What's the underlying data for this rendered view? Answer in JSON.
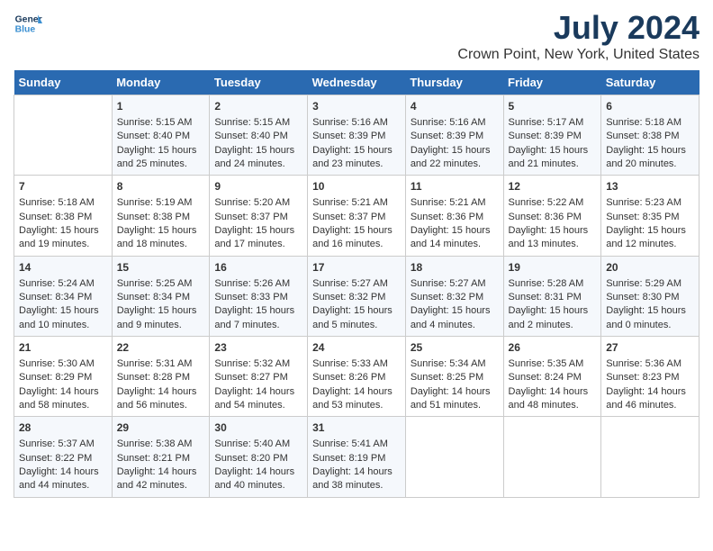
{
  "header": {
    "logo_line1": "General",
    "logo_line2": "Blue",
    "title": "July 2024",
    "subtitle": "Crown Point, New York, United States"
  },
  "weekdays": [
    "Sunday",
    "Monday",
    "Tuesday",
    "Wednesday",
    "Thursday",
    "Friday",
    "Saturday"
  ],
  "weeks": [
    [
      {
        "day": "",
        "lines": []
      },
      {
        "day": "1",
        "lines": [
          "Sunrise: 5:15 AM",
          "Sunset: 8:40 PM",
          "Daylight: 15 hours",
          "and 25 minutes."
        ]
      },
      {
        "day": "2",
        "lines": [
          "Sunrise: 5:15 AM",
          "Sunset: 8:40 PM",
          "Daylight: 15 hours",
          "and 24 minutes."
        ]
      },
      {
        "day": "3",
        "lines": [
          "Sunrise: 5:16 AM",
          "Sunset: 8:39 PM",
          "Daylight: 15 hours",
          "and 23 minutes."
        ]
      },
      {
        "day": "4",
        "lines": [
          "Sunrise: 5:16 AM",
          "Sunset: 8:39 PM",
          "Daylight: 15 hours",
          "and 22 minutes."
        ]
      },
      {
        "day": "5",
        "lines": [
          "Sunrise: 5:17 AM",
          "Sunset: 8:39 PM",
          "Daylight: 15 hours",
          "and 21 minutes."
        ]
      },
      {
        "day": "6",
        "lines": [
          "Sunrise: 5:18 AM",
          "Sunset: 8:38 PM",
          "Daylight: 15 hours",
          "and 20 minutes."
        ]
      }
    ],
    [
      {
        "day": "7",
        "lines": [
          "Sunrise: 5:18 AM",
          "Sunset: 8:38 PM",
          "Daylight: 15 hours",
          "and 19 minutes."
        ]
      },
      {
        "day": "8",
        "lines": [
          "Sunrise: 5:19 AM",
          "Sunset: 8:38 PM",
          "Daylight: 15 hours",
          "and 18 minutes."
        ]
      },
      {
        "day": "9",
        "lines": [
          "Sunrise: 5:20 AM",
          "Sunset: 8:37 PM",
          "Daylight: 15 hours",
          "and 17 minutes."
        ]
      },
      {
        "day": "10",
        "lines": [
          "Sunrise: 5:21 AM",
          "Sunset: 8:37 PM",
          "Daylight: 15 hours",
          "and 16 minutes."
        ]
      },
      {
        "day": "11",
        "lines": [
          "Sunrise: 5:21 AM",
          "Sunset: 8:36 PM",
          "Daylight: 15 hours",
          "and 14 minutes."
        ]
      },
      {
        "day": "12",
        "lines": [
          "Sunrise: 5:22 AM",
          "Sunset: 8:36 PM",
          "Daylight: 15 hours",
          "and 13 minutes."
        ]
      },
      {
        "day": "13",
        "lines": [
          "Sunrise: 5:23 AM",
          "Sunset: 8:35 PM",
          "Daylight: 15 hours",
          "and 12 minutes."
        ]
      }
    ],
    [
      {
        "day": "14",
        "lines": [
          "Sunrise: 5:24 AM",
          "Sunset: 8:34 PM",
          "Daylight: 15 hours",
          "and 10 minutes."
        ]
      },
      {
        "day": "15",
        "lines": [
          "Sunrise: 5:25 AM",
          "Sunset: 8:34 PM",
          "Daylight: 15 hours",
          "and 9 minutes."
        ]
      },
      {
        "day": "16",
        "lines": [
          "Sunrise: 5:26 AM",
          "Sunset: 8:33 PM",
          "Daylight: 15 hours",
          "and 7 minutes."
        ]
      },
      {
        "day": "17",
        "lines": [
          "Sunrise: 5:27 AM",
          "Sunset: 8:32 PM",
          "Daylight: 15 hours",
          "and 5 minutes."
        ]
      },
      {
        "day": "18",
        "lines": [
          "Sunrise: 5:27 AM",
          "Sunset: 8:32 PM",
          "Daylight: 15 hours",
          "and 4 minutes."
        ]
      },
      {
        "day": "19",
        "lines": [
          "Sunrise: 5:28 AM",
          "Sunset: 8:31 PM",
          "Daylight: 15 hours",
          "and 2 minutes."
        ]
      },
      {
        "day": "20",
        "lines": [
          "Sunrise: 5:29 AM",
          "Sunset: 8:30 PM",
          "Daylight: 15 hours",
          "and 0 minutes."
        ]
      }
    ],
    [
      {
        "day": "21",
        "lines": [
          "Sunrise: 5:30 AM",
          "Sunset: 8:29 PM",
          "Daylight: 14 hours",
          "and 58 minutes."
        ]
      },
      {
        "day": "22",
        "lines": [
          "Sunrise: 5:31 AM",
          "Sunset: 8:28 PM",
          "Daylight: 14 hours",
          "and 56 minutes."
        ]
      },
      {
        "day": "23",
        "lines": [
          "Sunrise: 5:32 AM",
          "Sunset: 8:27 PM",
          "Daylight: 14 hours",
          "and 54 minutes."
        ]
      },
      {
        "day": "24",
        "lines": [
          "Sunrise: 5:33 AM",
          "Sunset: 8:26 PM",
          "Daylight: 14 hours",
          "and 53 minutes."
        ]
      },
      {
        "day": "25",
        "lines": [
          "Sunrise: 5:34 AM",
          "Sunset: 8:25 PM",
          "Daylight: 14 hours",
          "and 51 minutes."
        ]
      },
      {
        "day": "26",
        "lines": [
          "Sunrise: 5:35 AM",
          "Sunset: 8:24 PM",
          "Daylight: 14 hours",
          "and 48 minutes."
        ]
      },
      {
        "day": "27",
        "lines": [
          "Sunrise: 5:36 AM",
          "Sunset: 8:23 PM",
          "Daylight: 14 hours",
          "and 46 minutes."
        ]
      }
    ],
    [
      {
        "day": "28",
        "lines": [
          "Sunrise: 5:37 AM",
          "Sunset: 8:22 PM",
          "Daylight: 14 hours",
          "and 44 minutes."
        ]
      },
      {
        "day": "29",
        "lines": [
          "Sunrise: 5:38 AM",
          "Sunset: 8:21 PM",
          "Daylight: 14 hours",
          "and 42 minutes."
        ]
      },
      {
        "day": "30",
        "lines": [
          "Sunrise: 5:40 AM",
          "Sunset: 8:20 PM",
          "Daylight: 14 hours",
          "and 40 minutes."
        ]
      },
      {
        "day": "31",
        "lines": [
          "Sunrise: 5:41 AM",
          "Sunset: 8:19 PM",
          "Daylight: 14 hours",
          "and 38 minutes."
        ]
      },
      {
        "day": "",
        "lines": []
      },
      {
        "day": "",
        "lines": []
      },
      {
        "day": "",
        "lines": []
      }
    ]
  ]
}
